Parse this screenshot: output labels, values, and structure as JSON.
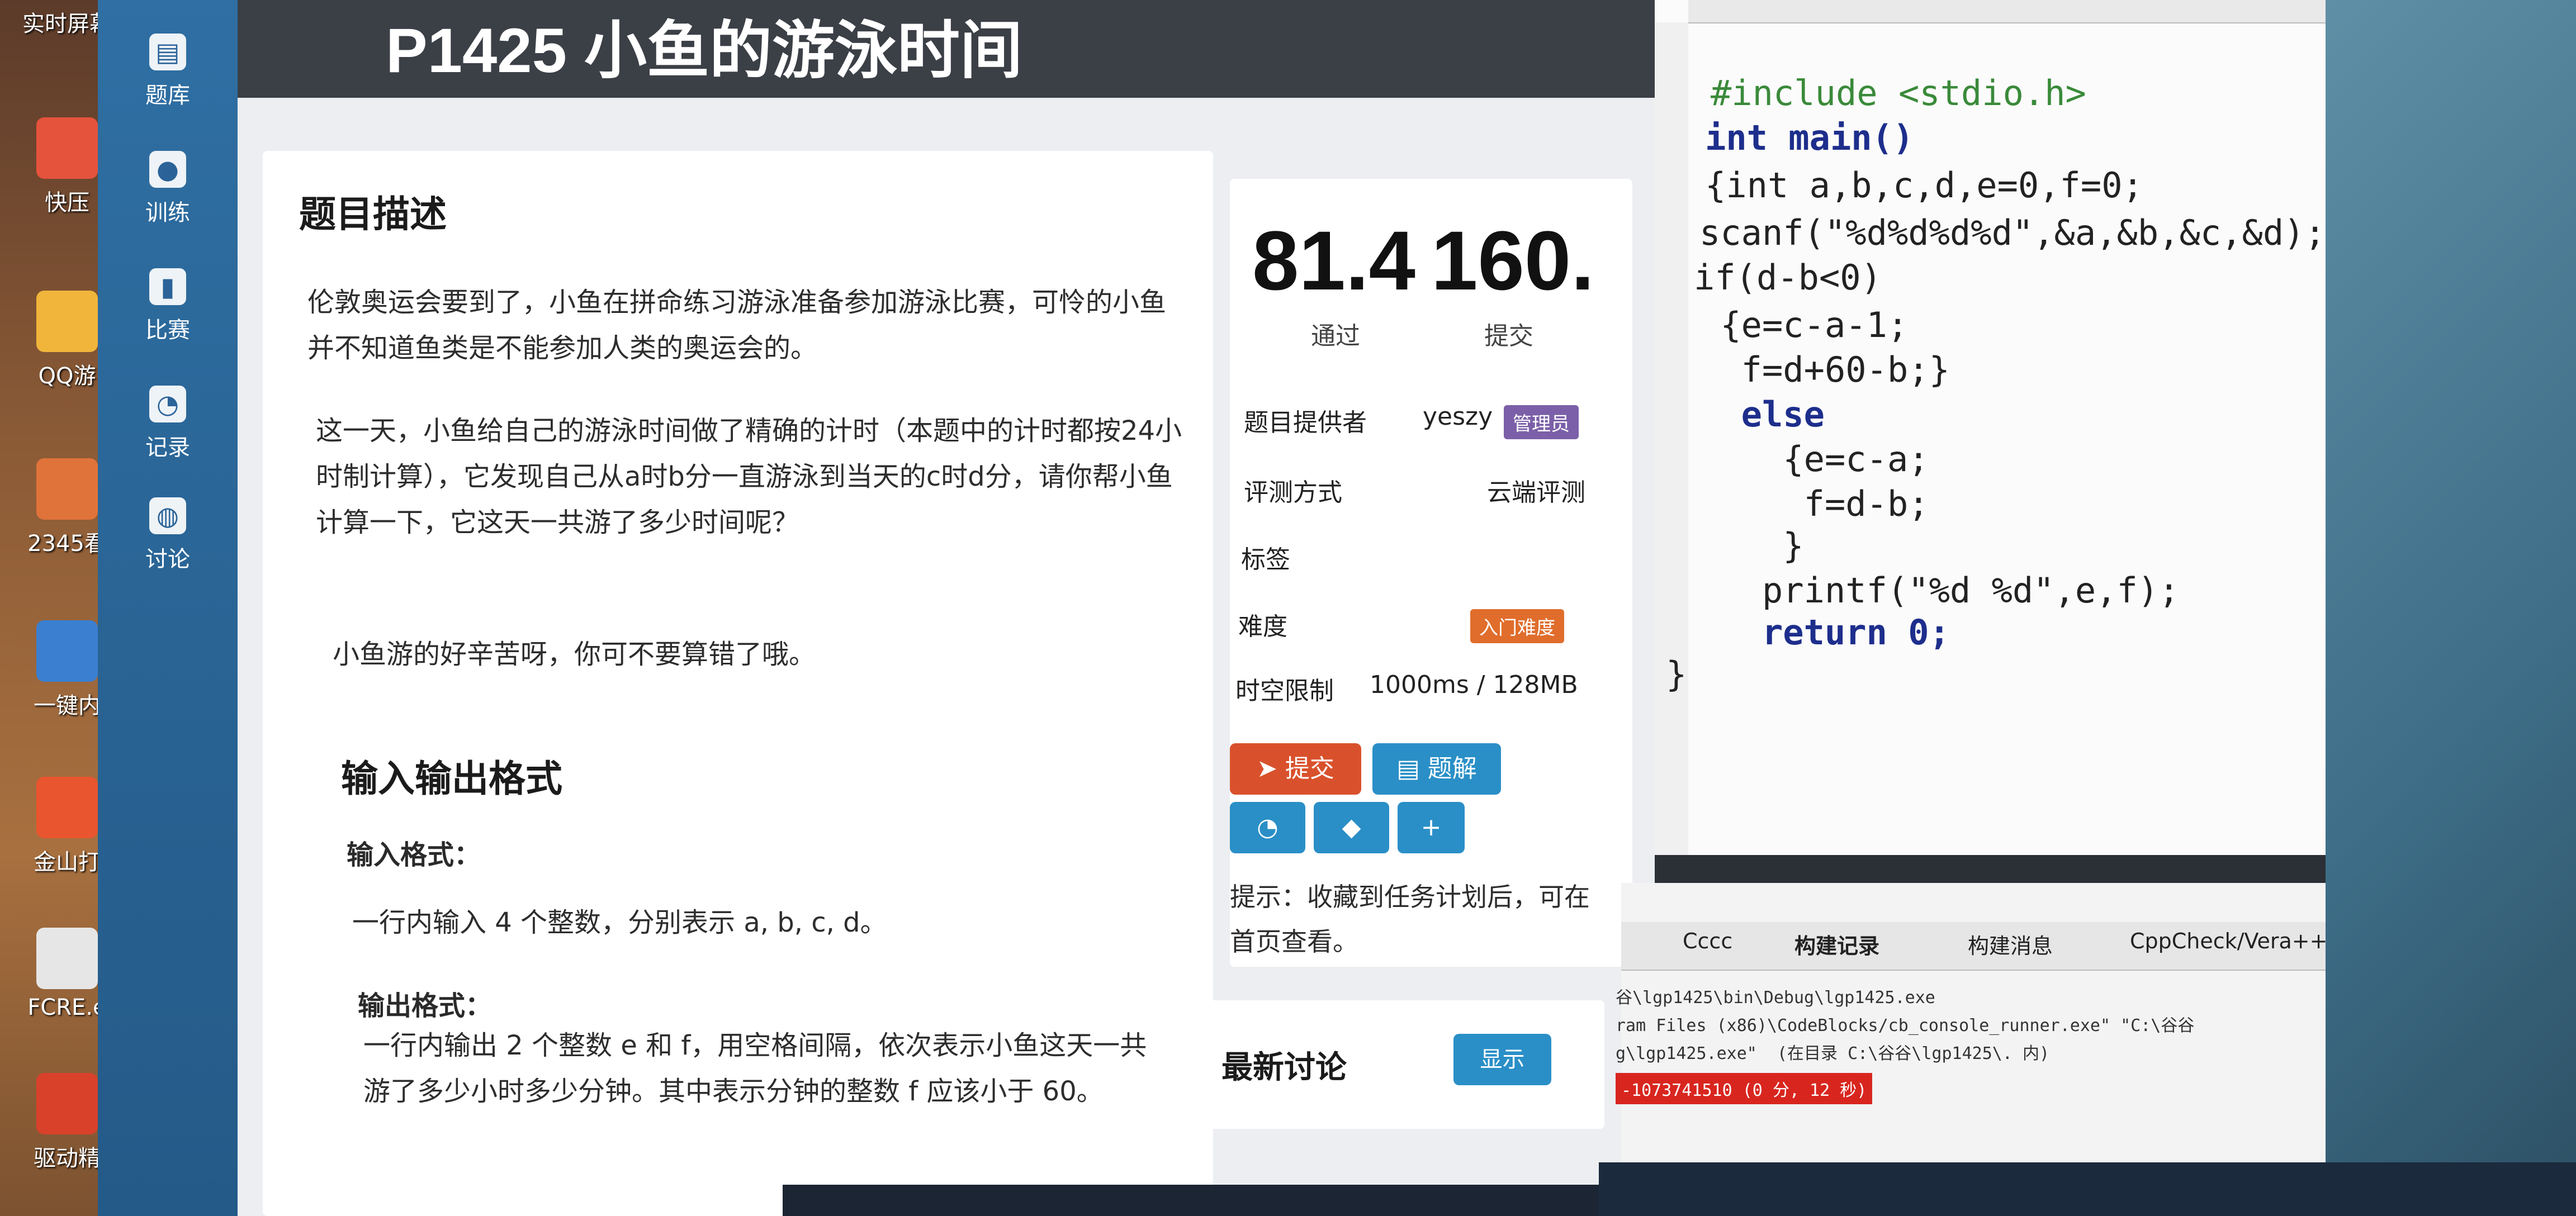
{
  "desktop": {
    "icons": [
      "实时屏幕",
      "快压",
      "QQ游",
      "2345看",
      "一键内",
      "金山打",
      "FCRE.e",
      "驱动精"
    ]
  },
  "site_nav": {
    "items": [
      {
        "label": "题库",
        "icon": "book-icon"
      },
      {
        "label": "训练",
        "icon": "bulb-icon"
      },
      {
        "label": "比赛",
        "icon": "bar-chart-icon"
      },
      {
        "label": "记录",
        "icon": "pie-chart-icon"
      },
      {
        "label": "讨论",
        "icon": "chat-icon"
      }
    ]
  },
  "problem": {
    "title": "P1425 小鱼的游泳时间",
    "description_heading": "题目描述",
    "description": [
      "伦敦奥运会要到了，小鱼在拼命练习游泳准备参加游泳比赛，可怜的小鱼并不知道鱼类是不能参加人类的奥运会的。",
      "这一天，小鱼给自己的游泳时间做了精确的计时（本题中的计时都按24小时制计算），它发现自己从a时b分一直游泳到当天的c时d分，请你帮小鱼计算一下，它这天一共游了多少时间呢？",
      "小鱼游的好辛苦呀，你可不要算错了哦。"
    ],
    "io_heading": "输入输出格式",
    "input_heading": "输入格式：",
    "input_text": "一行内输入 4 个整数，分别表示 a, b, c, d。",
    "output_heading": "输出格式：",
    "output_text": "一行内输出 2 个整数 e 和 f，用空格间隔，依次表示小鱼这天一共游了多少小时多少分钟。其中表示分钟的整数 f 应该小于 60。"
  },
  "stats": {
    "pass_value": "81.4",
    "pass_label": "通过",
    "submit_value": "160.",
    "submit_label": "提交",
    "provider_label": "题目提供者",
    "provider_value": "yeszy",
    "provider_badge": "管理员",
    "judge_label": "评测方式",
    "judge_value": "云端评测",
    "tags_label": "标签",
    "difficulty_label": "难度",
    "difficulty_value": "入门难度",
    "limit_label": "时空限制",
    "limit_value": "1000ms / 128MB",
    "submit_button": "提交",
    "solution_button": "题解",
    "hint": "提示：收藏到任务计划后，可在首页查看。",
    "latest_discussion": "最新讨论",
    "show_button": "显示",
    "colors": {
      "accent_red": "#d9512c",
      "accent_blue": "#2a8fc7",
      "badge_purple": "#7b5fa8",
      "badge_orange": "#e06d2c"
    }
  },
  "editor": {
    "lines": [
      "#include <stdio.h>",
      "int main()",
      "{int a,b,c,d,e=0,f=0;",
      "scanf(\"%d%d%d%d\",&a,&b,&c,&d);",
      "if(d-b<0)",
      " {e=c-a-1;",
      "  f=d+60-b;}",
      "  else",
      "    {e=c-a;",
      "     f=d-b;",
      "    }",
      "   printf(\"%d %d\",e,f);",
      "   return 0;",
      "}"
    ]
  },
  "log_panel": {
    "tabs": [
      "Cccc",
      "构建记录",
      "构建消息",
      "CppCheck/Vera++"
    ],
    "lines": [
      "谷\\lgp1425\\bin\\Debug\\lgp1425.exe",
      "ram Files (x86)\\CodeBlocks/cb_console_runner.exe\" \"C:\\谷谷",
      "g\\lgp1425.exe\"  (在目录 C:\\谷谷\\lgp1425\\. 内)",
      "-1073741510 (0 分, 12 秒)"
    ]
  }
}
